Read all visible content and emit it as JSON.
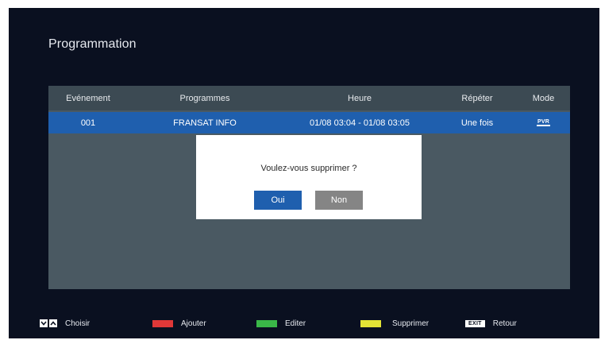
{
  "page": {
    "title": "Programmation"
  },
  "table": {
    "columns": [
      "Evénement",
      "Programmes",
      "Heure",
      "Répéter",
      "Mode"
    ],
    "rows": [
      {
        "event": "001",
        "programme": "FRANSAT INFO",
        "time": "01/08 03:04 - 01/08 03:05",
        "repeat": "Une fois",
        "mode_icon": "pvr-icon",
        "mode_text": "PVR"
      }
    ]
  },
  "dialog": {
    "message": "Voulez-vous supprimer ?",
    "yes_label": "Oui",
    "no_label": "Non"
  },
  "footer": {
    "choose_label": "Choisir",
    "add_label": "Ajouter",
    "edit_label": "Editer",
    "delete_label": "Supprimer",
    "exit_key_label": "EXIT",
    "back_label": "Retour"
  },
  "colors": {
    "red_key": "#e03838",
    "green_key": "#3ab848",
    "yellow_key": "#e2e236",
    "selection": "#1f5fae"
  }
}
